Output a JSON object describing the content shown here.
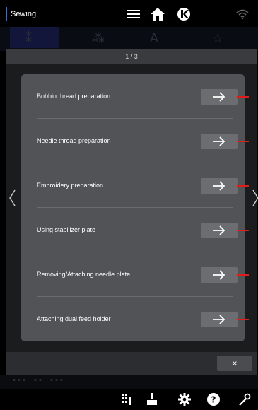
{
  "topbar": {
    "mode_label": "Sewing",
    "icons": [
      "menu-icon",
      "home-icon",
      "brand-logo-icon",
      "wifi-icon"
    ]
  },
  "dialog": {
    "page_indicator": "1 / 3",
    "close_label": "×",
    "items": [
      {
        "label": "Bobbin thread preparation"
      },
      {
        "label": "Needle thread preparation"
      },
      {
        "label": "Embroidery preparation"
      },
      {
        "label": "Using stabilizer plate"
      },
      {
        "label": "Removing/Attaching needle plate"
      },
      {
        "label": "Attaching dual feed holder"
      }
    ]
  },
  "bottombar": {
    "icons": [
      "stitch-pattern-icon",
      "needle-icon",
      "settings-icon",
      "help-icon",
      "tools-icon"
    ]
  },
  "colors": {
    "accent": "#2f6fd6",
    "pointer": "#e11a1a",
    "panel": "#525357",
    "button": "#6c6d71"
  }
}
